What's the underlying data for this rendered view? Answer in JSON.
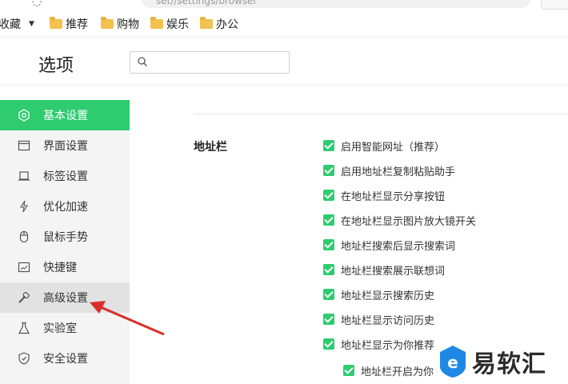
{
  "browser": {
    "url_partial": "set//settings/browser"
  },
  "bookmarks": {
    "favorites_label": "收藏",
    "folders": [
      "推荐",
      "购物",
      "娱乐",
      "办公"
    ]
  },
  "header": {
    "title": "选项",
    "search_placeholder": ""
  },
  "sidebar": {
    "items": [
      {
        "label": "基本设置",
        "icon": "gear-icon",
        "state": "active"
      },
      {
        "label": "界面设置",
        "icon": "window-icon",
        "state": "normal"
      },
      {
        "label": "标签设置",
        "icon": "tab-icon",
        "state": "normal"
      },
      {
        "label": "优化加速",
        "icon": "lightning-icon",
        "state": "normal"
      },
      {
        "label": "鼠标手势",
        "icon": "mouse-icon",
        "state": "normal"
      },
      {
        "label": "快捷键",
        "icon": "keyboard-icon",
        "state": "normal"
      },
      {
        "label": "高级设置",
        "icon": "wrench-icon",
        "state": "hover"
      },
      {
        "label": "实验室",
        "icon": "flask-icon",
        "state": "normal"
      },
      {
        "label": "安全设置",
        "icon": "shield-icon",
        "state": "normal"
      }
    ]
  },
  "main": {
    "section_label": "地址栏",
    "options": [
      {
        "label": "启用智能网址（推荐）",
        "checked": true
      },
      {
        "label": "启用地址栏复制粘贴助手",
        "checked": true
      },
      {
        "label": "在地址栏显示分享按钮",
        "checked": true
      },
      {
        "label": "在地址栏显示图片放大镜开关",
        "checked": true
      },
      {
        "label": "地址栏搜索后显示搜索词",
        "checked": true
      },
      {
        "label": "地址栏搜索展示联想词",
        "checked": true
      },
      {
        "label": "地址栏显示搜索历史",
        "checked": true
      },
      {
        "label": "地址栏显示访问历史",
        "checked": true
      },
      {
        "label": "地址栏显示为你推荐",
        "checked": true
      }
    ],
    "sub_option": {
      "label": "地址栏开启为你",
      "checked": true
    }
  },
  "watermark": {
    "text": "易软汇"
  },
  "colors": {
    "accent": "#2ecc6f",
    "annotation": "#d9302c"
  }
}
